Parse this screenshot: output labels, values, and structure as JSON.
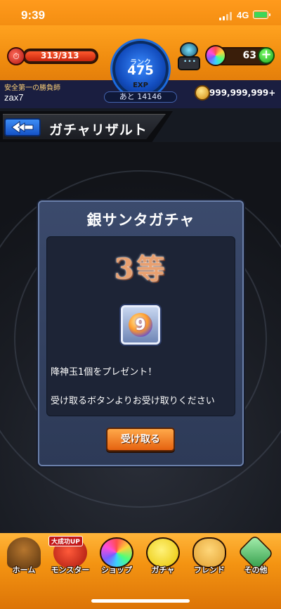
{
  "status_bar": {
    "time": "9:39",
    "network": "4G",
    "battery_level": 1.0
  },
  "hud": {
    "stamina": "313/313",
    "rank_label": "ランク",
    "rank": "475",
    "exp_label": "EXP",
    "exp_remaining": "あと 14146",
    "player_title": "安全第一の勝負師",
    "player_name": "zax7",
    "orb_count": "63",
    "add_orb": "+",
    "coins": "999,999,999+"
  },
  "header": {
    "title": "ガチャリザルト"
  },
  "dialog": {
    "title": "銀サンタガチャ",
    "result": "3等",
    "item_glyph": "9",
    "message_1": "降神玉1個をプレゼント！",
    "message_2": "受け取るボタンよりお受け取りください",
    "receive_button": "受け取る"
  },
  "bottom_nav": {
    "badge": "大成功UP",
    "items": [
      {
        "label": "ホーム",
        "icon": "home-icon"
      },
      {
        "label": "モンスター",
        "icon": "monster-icon"
      },
      {
        "label": "ショップ",
        "icon": "shop-icon"
      },
      {
        "label": "ガチャ",
        "icon": "gacha-icon"
      },
      {
        "label": "フレンド",
        "icon": "friend-icon"
      },
      {
        "label": "その他",
        "icon": "other-icon"
      }
    ]
  },
  "colors": {
    "hud_orange": "#f08a0e",
    "dialog_blue": "#3b4a6c",
    "result_text": "#e8a070",
    "button_orange": "#e56210",
    "back_button_blue": "#1552c6"
  }
}
